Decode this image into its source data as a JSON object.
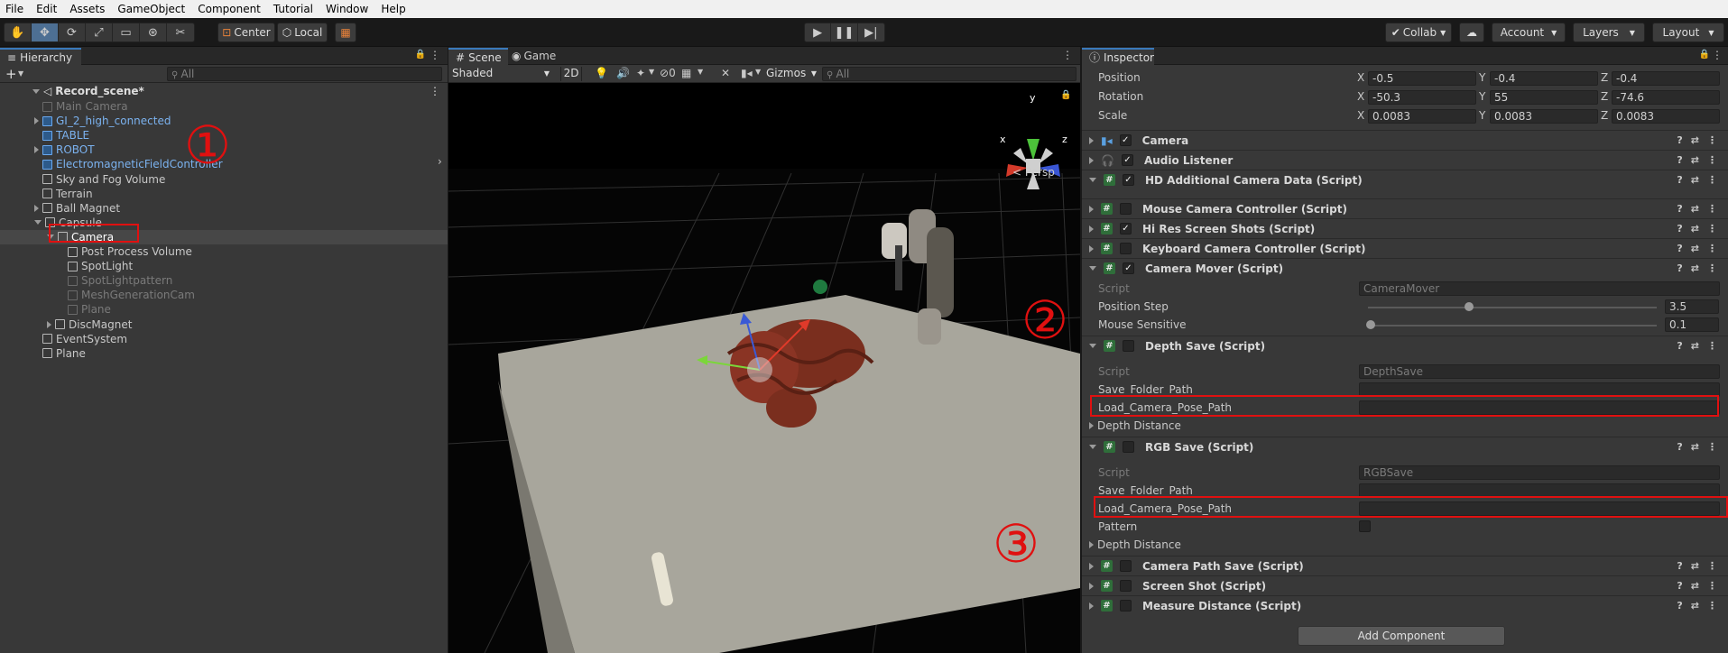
{
  "menu": [
    "File",
    "Edit",
    "Assets",
    "GameObject",
    "Component",
    "Tutorial",
    "Window",
    "Help"
  ],
  "toolbar": {
    "center_label": "Center",
    "local_label": "Local",
    "collab_label": "Collab",
    "account_label": "Account",
    "layers_label": "Layers",
    "layout_label": "Layout"
  },
  "hierarchy": {
    "tab": "Hierarchy",
    "search_placeholder": "All",
    "scene_name": "Record_scene*",
    "items": [
      {
        "label": "Main Camera",
        "indent": 1,
        "style": "dim"
      },
      {
        "label": "GI_2_high_connected",
        "indent": 1,
        "style": "blue",
        "fold": "right"
      },
      {
        "label": "TABLE",
        "indent": 1,
        "style": "blue"
      },
      {
        "label": "ROBOT",
        "indent": 1,
        "style": "blue",
        "fold": "right"
      },
      {
        "label": "ElectromagneticFieldController",
        "indent": 1,
        "style": "blue"
      },
      {
        "label": "Sky and Fog Volume",
        "indent": 1,
        "style": "normal"
      },
      {
        "label": "Terrain",
        "indent": 1,
        "style": "normal"
      },
      {
        "label": "Ball Magnet",
        "indent": 1,
        "style": "normal",
        "fold": "right"
      },
      {
        "label": "Capsule",
        "indent": 1,
        "style": "normal",
        "fold": "down"
      },
      {
        "label": "Camera",
        "indent": 2,
        "style": "selected",
        "fold": "down"
      },
      {
        "label": "Post Process Volume",
        "indent": 3,
        "style": "normal"
      },
      {
        "label": "SpotLight",
        "indent": 3,
        "style": "normal"
      },
      {
        "label": "SpotLightpattern",
        "indent": 3,
        "style": "dim"
      },
      {
        "label": "MeshGenerationCam",
        "indent": 3,
        "style": "dim"
      },
      {
        "label": "Plane",
        "indent": 3,
        "style": "dim"
      },
      {
        "label": "DiscMagnet",
        "indent": 2,
        "style": "normal",
        "fold": "right"
      },
      {
        "label": "EventSystem",
        "indent": 1,
        "style": "normal"
      },
      {
        "label": "Plane",
        "indent": 1,
        "style": "normal"
      }
    ]
  },
  "scene": {
    "tab_scene": "Scene",
    "tab_game": "Game",
    "shading": "Shaded",
    "mode_2d": "2D",
    "hidden_count": "0",
    "gizmos_label": "Gizmos",
    "search_placeholder": "All",
    "persp_label": "< Persp",
    "axis_x": "x",
    "axis_y": "y",
    "axis_z": "z"
  },
  "inspector": {
    "tab": "Inspector",
    "transform": [
      {
        "label": "Position",
        "x": "-0.5",
        "y": "-0.4",
        "z": "-0.4"
      },
      {
        "label": "Rotation",
        "x": "-50.3",
        "y": "55",
        "z": "-74.6"
      },
      {
        "label": "Scale",
        "x": "0.0083",
        "y": "0.0083",
        "z": "0.0083"
      }
    ],
    "axis_labels": [
      "X",
      "Y",
      "Z"
    ],
    "components_top": [
      {
        "name": "Camera",
        "checked": true,
        "icon": "camera-icon"
      },
      {
        "name": "Audio Listener",
        "checked": true,
        "icon": "headphones-icon"
      },
      {
        "name": "HD Additional Camera Data (Script)",
        "checked": true,
        "icon": "script-icon"
      },
      {
        "name": "Mouse Camera Controller (Script)",
        "checked": false,
        "icon": "script-icon"
      },
      {
        "name": "Hi Res Screen Shots (Script)",
        "checked": true,
        "icon": "script-icon"
      },
      {
        "name": "Keyboard Camera Controller (Script)",
        "checked": false,
        "icon": "script-icon"
      },
      {
        "name": "Camera Mover (Script)",
        "checked": true,
        "icon": "script-icon"
      }
    ],
    "camera_mover": {
      "script_label": "Script",
      "script_value": "CameraMover",
      "position_step_label": "Position Step",
      "position_step_value": "3.5",
      "position_step_fraction": 0.35,
      "mouse_sensitive_label": "Mouse Sensitive",
      "mouse_sensitive_value": "0.1",
      "mouse_sensitive_fraction": 0.01
    },
    "depth_save": {
      "name": "Depth Save (Script)",
      "script_label": "Script",
      "script_value": "DepthSave",
      "save_folder_label": "Save_Folder_Path",
      "load_pose_label": "Load_Camera_Pose_Path",
      "depth_distance_label": "Depth Distance"
    },
    "rgb_save": {
      "name": "RGB Save (Script)",
      "script_label": "Script",
      "script_value": "RGBSave",
      "save_folder_label": "Save_Folder_Path",
      "load_pose_label": "Load_Camera_Pose_Path",
      "pattern_label": "Pattern",
      "depth_distance_label": "Depth Distance"
    },
    "components_bottom": [
      {
        "name": "Camera Path Save (Script)",
        "checked": false
      },
      {
        "name": "Screen Shot (Script)",
        "checked": false
      },
      {
        "name": "Measure Distance (Script)",
        "checked": false
      }
    ],
    "add_component_label": "Add Component"
  },
  "annotations": {
    "one": "①",
    "two": "②",
    "three": "③"
  },
  "colors": {
    "accent": "#4d6f93",
    "selection": "#2c5d87",
    "annotation": "#e01010",
    "table": "#a8a69c",
    "background": "#000000"
  }
}
